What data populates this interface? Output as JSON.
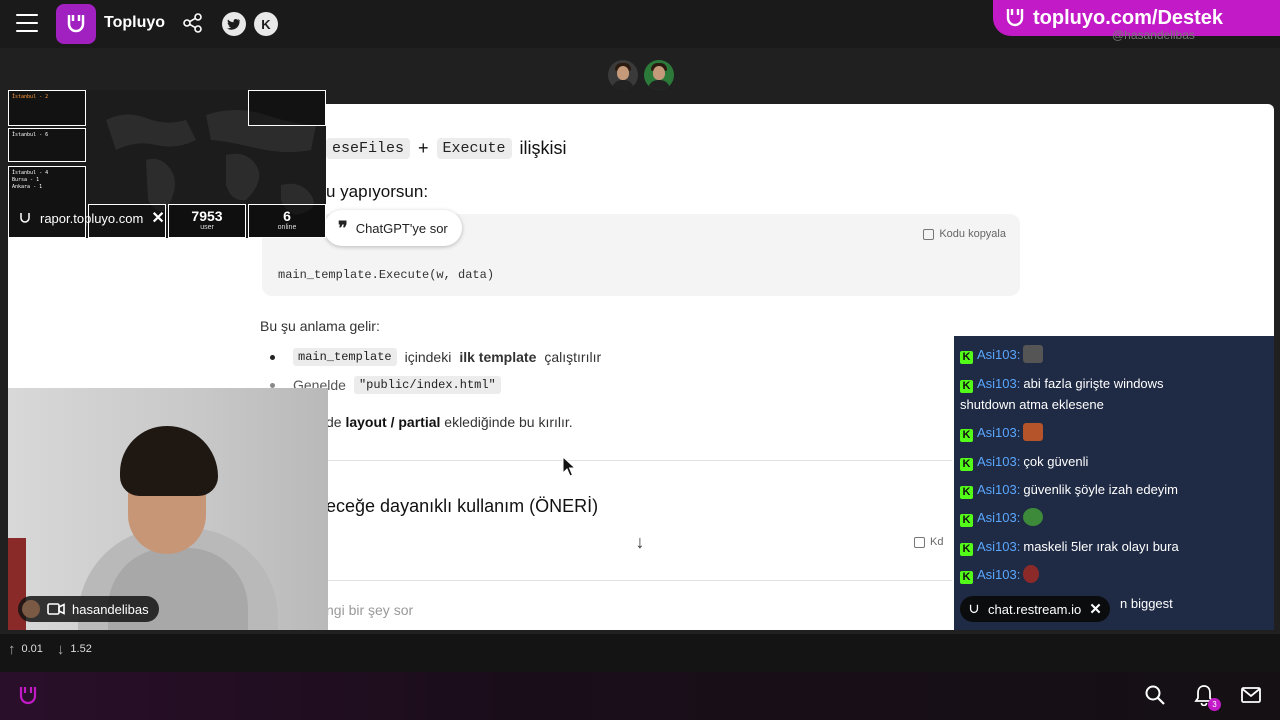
{
  "topbar": {
    "brand": "Topluyo",
    "donate_link": "topluyo.com/Destek",
    "faint_handle": "@hasandelibas"
  },
  "overlay": {
    "rapor_url": "rapor.topluyo.com",
    "user_count": "7953",
    "user_label": "user",
    "online_count": "6",
    "online_label": "online",
    "box1_lines": [
      "İstanbul - 2"
    ],
    "box2_lines": [
      "İstanbul - 6"
    ],
    "box3_lines": [
      "İstanbul - 4",
      "Bursa - 1",
      "Ankara - 1"
    ]
  },
  "document": {
    "heading1_code1": "eseFiles",
    "heading1_plus": "+",
    "heading1_code2": "Execute",
    "heading1_text": "ilişkisi",
    "heading2": "u yapıyorsun:",
    "ask_gpt_label": "ChatGPT'ye sor",
    "copy_label": "Kodu kopyala",
    "code_line": "main_template.Execute(w, data)",
    "paragraph": "Bu şu anlama gelir:",
    "bullet1_code": "main_template",
    "bullet1_text": "içindeki",
    "bullet1_bold": "ilk template",
    "bullet1_tail": "çalıştırılır",
    "bullet2_text": "Genelde",
    "bullet2_code": "\"public/index.html\"",
    "para2_pre": "de",
    "para2_bold": "layout / partial",
    "para2_tail": "eklediğinde bu kırılır.",
    "heading3": "eceğe dayanıklı kullanım (ÖNERİ)",
    "copy_label2": "Kd",
    "prompt_placeholder": "ngi bir şey sor"
  },
  "webcam": {
    "username": "hasandelibas"
  },
  "chat": {
    "messages": [
      {
        "user": "Asi103",
        "text": "",
        "emote": "e1"
      },
      {
        "user": "Asi103",
        "text": "abi fazla girişte windows",
        "emote": ""
      },
      {
        "user": "",
        "text": "shutdown atma eklesene",
        "emote": ""
      },
      {
        "user": "Asi103",
        "text": "",
        "emote": "e2"
      },
      {
        "user": "Asi103",
        "text": "çok güvenli",
        "emote": ""
      },
      {
        "user": "Asi103",
        "text": "güvenlik şöyle izah edeyim",
        "emote": ""
      },
      {
        "user": "Asi103",
        "text": "",
        "emote": "e3"
      },
      {
        "user": "Asi103",
        "text": "maskeli 5ler ırak olayı bura",
        "emote": ""
      },
      {
        "user": "Asi103",
        "text": "",
        "emote": "e4"
      },
      {
        "user": "",
        "text": "n biggest",
        "emote": ""
      }
    ],
    "restream_label": "chat.restream.io"
  },
  "stats": {
    "up_value": "0.01",
    "down_value": "1.52"
  },
  "notifications": {
    "badge_count": "3"
  },
  "colors": {
    "brand_purple": "#c21ac7",
    "chat_bg": "#1f2a44",
    "kick_green": "#53fc18"
  }
}
